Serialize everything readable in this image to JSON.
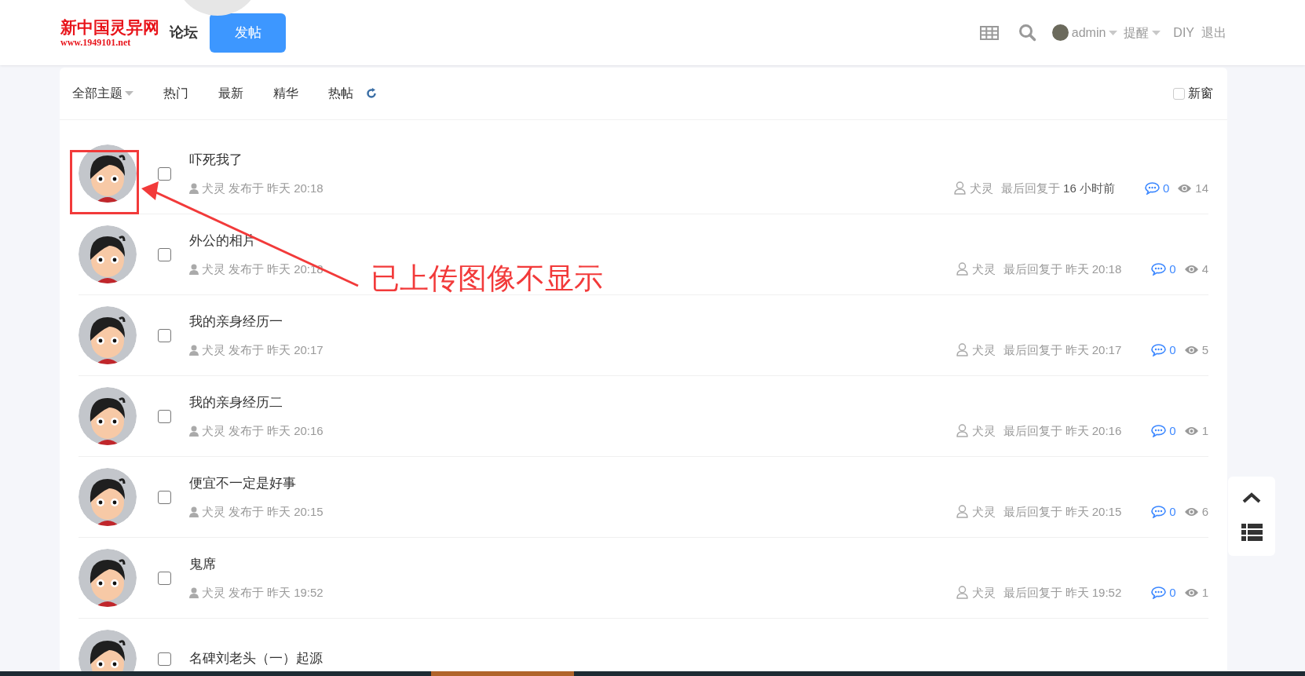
{
  "header": {
    "logo_title": "新中国灵异网",
    "logo_url": "www.1949101.net",
    "forum_link": "论坛",
    "post_button": "发帖",
    "user_name": "admin",
    "notice_menu": "提醒",
    "diy_link": "DIY",
    "logout_link": "退出"
  },
  "filter_tabs": [
    {
      "label": "全部主题",
      "kind": "dropdown",
      "selected": false
    },
    {
      "label": "热门",
      "kind": "plain",
      "selected": false
    },
    {
      "label": "最新",
      "kind": "plain",
      "selected": false
    },
    {
      "label": "精华",
      "kind": "plain",
      "selected": false
    },
    {
      "label": "热帖",
      "kind": "plain",
      "selected": false
    }
  ],
  "new_window": {
    "label": "新窗",
    "checked": false
  },
  "threads": [
    {
      "title": "吓死我了",
      "checked": false,
      "author": "犬灵",
      "posted_label": "发布于",
      "posted_time": "昨天 20:18",
      "last_replier": "犬灵",
      "last_reply_label": "最后回复于",
      "last_reply_time": "16 小时前",
      "last_reply_highlighted": true,
      "replies": "0",
      "views": "14"
    },
    {
      "title": "外公的相片",
      "checked": false,
      "author": "犬灵",
      "posted_label": "发布于",
      "posted_time": "昨天 20:18",
      "last_replier": "犬灵",
      "last_reply_label": "最后回复于",
      "last_reply_time": "昨天 20:18",
      "last_reply_highlighted": false,
      "replies": "0",
      "views": "4"
    },
    {
      "title": "我的亲身经历一",
      "checked": false,
      "author": "犬灵",
      "posted_label": "发布于",
      "posted_time": "昨天 20:17",
      "last_replier": "犬灵",
      "last_reply_label": "最后回复于",
      "last_reply_time": "昨天 20:17",
      "last_reply_highlighted": false,
      "replies": "0",
      "views": "5"
    },
    {
      "title": "我的亲身经历二",
      "checked": false,
      "author": "犬灵",
      "posted_label": "发布于",
      "posted_time": "昨天 20:16",
      "last_replier": "犬灵",
      "last_reply_label": "最后回复于",
      "last_reply_time": "昨天 20:16",
      "last_reply_highlighted": false,
      "replies": "0",
      "views": "1"
    },
    {
      "title": "便宜不一定是好事",
      "checked": false,
      "author": "犬灵",
      "posted_label": "发布于",
      "posted_time": "昨天 20:15",
      "last_replier": "犬灵",
      "last_reply_label": "最后回复于",
      "last_reply_time": "昨天 20:15",
      "last_reply_highlighted": false,
      "replies": "0",
      "views": "6"
    },
    {
      "title": "鬼席",
      "checked": false,
      "author": "犬灵",
      "posted_label": "发布于",
      "posted_time": "昨天 19:52",
      "last_replier": "犬灵",
      "last_reply_label": "最后回复于",
      "last_reply_time": "昨天 19:52",
      "last_reply_highlighted": false,
      "replies": "0",
      "views": "1"
    },
    {
      "title": "名碑刘老头（一）起源",
      "checked": false
    }
  ],
  "annotation": {
    "text": "已上传图像不显示"
  }
}
